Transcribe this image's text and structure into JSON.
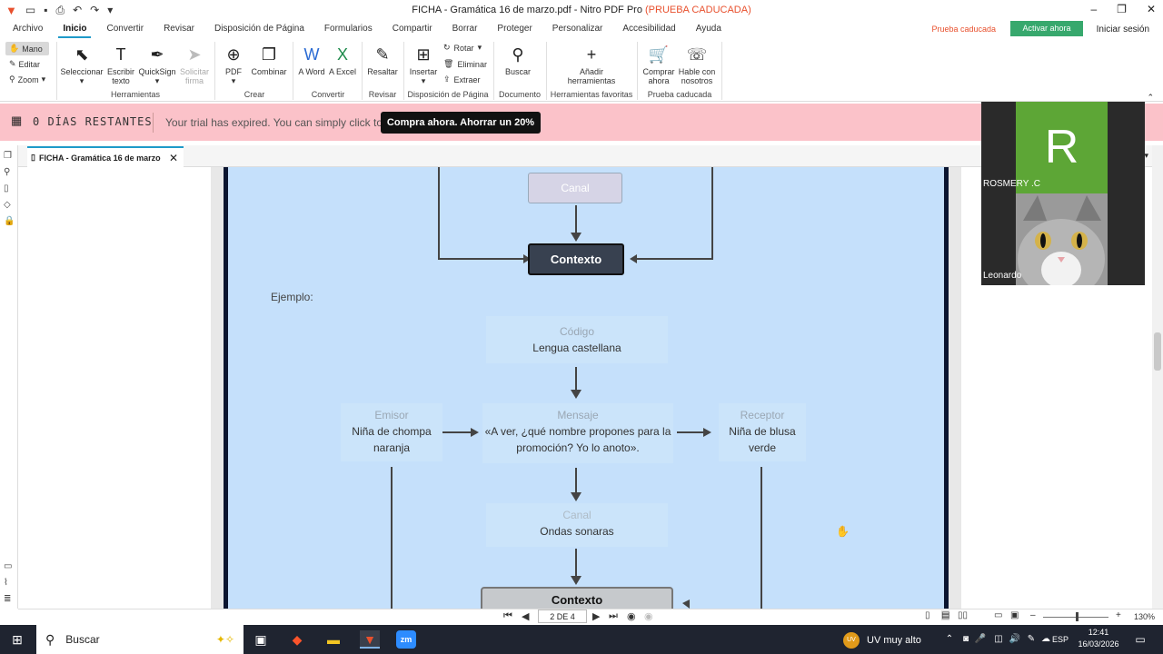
{
  "window": {
    "title": "FICHA - Gramática 16 de marzo.pdf - Nitro PDF Pro",
    "title_status": "(PRUEBA CADUCADA)"
  },
  "menu": {
    "items": [
      "Archivo",
      "Inicio",
      "Convertir",
      "Revisar",
      "Disposición de Página",
      "Formularios",
      "Compartir",
      "Borrar",
      "Proteger",
      "Personalizar",
      "Accesibilidad",
      "Ayuda"
    ],
    "active": "Inicio",
    "trial_status": "Prueba caducada",
    "activate": "Activar ahora",
    "signin": "Iniciar sesión"
  },
  "ribbon": {
    "modes": [
      "Mano",
      "Editar",
      "Zoom"
    ],
    "buttons": {
      "select": "Seleccionar",
      "write_text": "Escribir texto",
      "quicksign": "QuickSign",
      "request_sign": "Solicitar firma",
      "pdf": "PDF",
      "combine": "Combinar",
      "to_word": "A Word",
      "to_excel": "A Excel",
      "highlight": "Resaltar",
      "insert": "Insertar",
      "rotate": "Rotar",
      "delete": "Eliminar",
      "extract": "Extraer",
      "search": "Buscar",
      "add_tools": "Añadir herramientas",
      "buy_now": "Comprar ahora",
      "talk_to_us": "Hable con nosotros"
    },
    "groups": [
      "Herramientas",
      "Crear",
      "Convertir",
      "Revisar",
      "Disposición de Página",
      "Documento",
      "Herramientas favoritas",
      "Prueba caducada"
    ]
  },
  "banner": {
    "days": "0 DÍAS RESTANTES",
    "message": "Your trial has expired. You can simply click to",
    "cta": "Compra ahora. Ahorrar un 20%"
  },
  "tab": {
    "label": "FICHA - Gramática 16 de marzo"
  },
  "document": {
    "top_label": "Canal",
    "top_context": "Contexto",
    "example_label": "Ejemplo:",
    "code_label": "Código",
    "code_value": "Lengua castellana",
    "sender_label": "Emisor",
    "sender_value": "Niña de chompa naranja",
    "message_label": "Mensaje",
    "message_value": "«A ver, ¿qué nombre propones para la promoción? Yo lo anoto».",
    "receiver_label": "Receptor",
    "receiver_value": "Niña de blusa verde",
    "channel_label": "Canal",
    "channel_value": "Ondas sonaras",
    "bottom_context": "Contexto"
  },
  "navigation": {
    "page_indicator": "2 DE 4",
    "zoom": "130%"
  },
  "video": {
    "participant1_initial": "R",
    "participant1_name": "ROSMERY .C",
    "participant2_name": "Leonardo"
  },
  "taskbar": {
    "search_placeholder": "Buscar",
    "weather": "UV muy alto",
    "weather_badge": "UV",
    "lang": "ESP",
    "time": "12:41",
    "date": "16/03/2026"
  }
}
